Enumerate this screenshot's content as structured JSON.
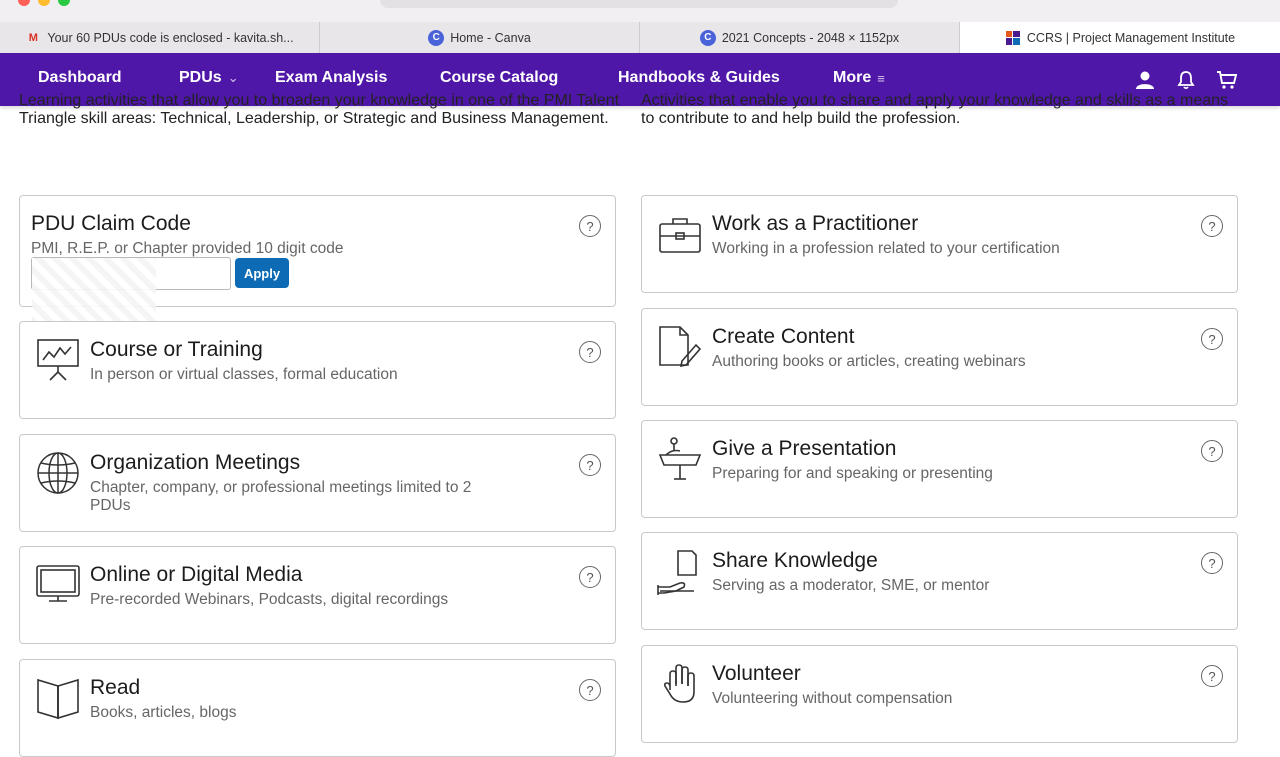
{
  "browser": {
    "tabs": [
      {
        "label": "Your 60 PDUs code is enclosed - kavita.sh...",
        "icon": "gmail-icon"
      },
      {
        "label": "Home - Canva",
        "icon": "canva-icon"
      },
      {
        "label": "2021 Concepts - 2048 × 1152px",
        "icon": "canva-icon"
      },
      {
        "label": "CCRS | Project Management Institute",
        "icon": "pmi-icon",
        "active": true
      }
    ]
  },
  "nav": {
    "items": [
      "Dashboard",
      "PDUs",
      "Exam Analysis",
      "Course Catalog",
      "Handbooks & Guides",
      "More"
    ],
    "icons": [
      "user-icon",
      "bell-icon",
      "cart-icon"
    ],
    "color": "#4f17a8"
  },
  "intro": {
    "left": "Learning activities that allow you to broaden your knowledge in one of the PMI Talent Triangle skill areas: Technical, Leadership, or Strategic and Business Management.",
    "right": "Activities that enable you to share and apply your knowledge and skills as a means to contribute to and help build the profession."
  },
  "claim": {
    "title": "PDU Claim Code",
    "sub": "PMI, R.E.P. or Chapter provided 10 digit code",
    "input_value": "",
    "apply_label": "Apply",
    "apply_color": "#0d6bb5"
  },
  "left_cards": [
    {
      "title": "Course or Training",
      "sub": "In person or virtual classes, formal education",
      "icon": "presentation-board-icon"
    },
    {
      "title": "Organization Meetings",
      "sub": "Chapter, company, or professional meetings limited to 2 PDUs",
      "icon": "globe-icon"
    },
    {
      "title": "Online or Digital Media",
      "sub": "Pre-recorded Webinars, Podcasts, digital recordings",
      "icon": "monitor-icon"
    },
    {
      "title": "Read",
      "sub": "Books, articles, blogs",
      "icon": "book-icon"
    }
  ],
  "right_cards": [
    {
      "title": "Work as a Practitioner",
      "sub": "Working in a profession related to your certification",
      "icon": "briefcase-icon"
    },
    {
      "title": "Create Content",
      "sub": "Authoring books or articles, creating webinars",
      "icon": "document-pencil-icon"
    },
    {
      "title": "Give a Presentation",
      "sub": "Preparing for and speaking or presenting",
      "icon": "podium-icon"
    },
    {
      "title": "Share Knowledge",
      "sub": "Serving as a moderator, SME, or mentor",
      "icon": "hand-document-icon"
    },
    {
      "title": "Volunteer",
      "sub": "Volunteering without compensation",
      "icon": "raised-hand-icon"
    }
  ],
  "help_glyph": "?"
}
